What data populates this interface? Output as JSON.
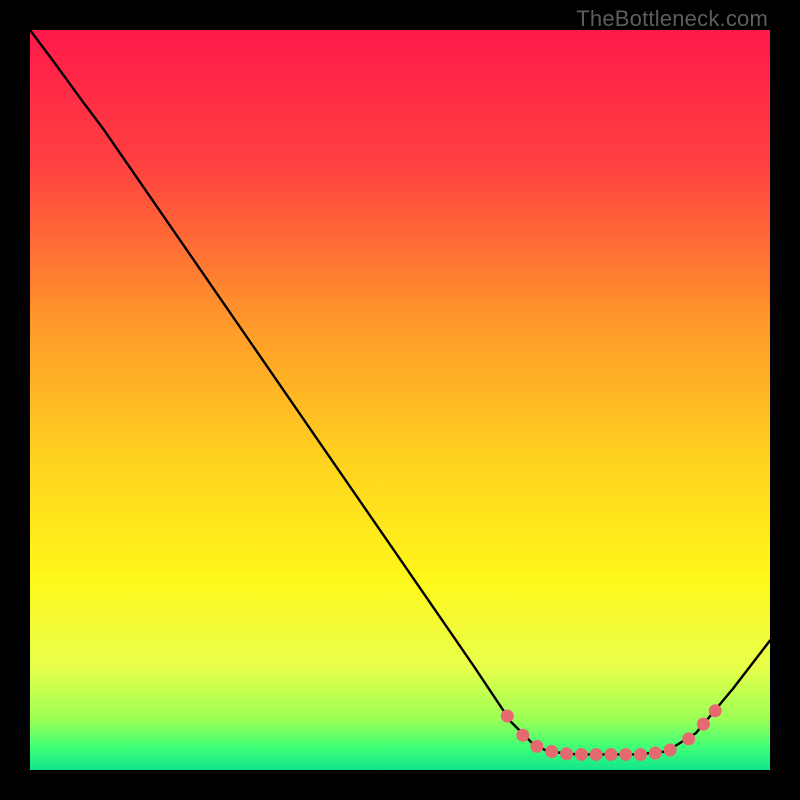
{
  "attribution": "TheBottleneck.com",
  "chart_data": {
    "type": "line",
    "title": "",
    "xlabel": "",
    "ylabel": "",
    "xlim": [
      0,
      100
    ],
    "ylim": [
      0,
      100
    ],
    "gradient_stops": [
      {
        "offset": 0,
        "color": "#ff1a4b"
      },
      {
        "offset": 18,
        "color": "#ff4040"
      },
      {
        "offset": 40,
        "color": "#ff9a2a"
      },
      {
        "offset": 58,
        "color": "#ffd21f"
      },
      {
        "offset": 74,
        "color": "#fff71a"
      },
      {
        "offset": 86,
        "color": "#e8ff4a"
      },
      {
        "offset": 93,
        "color": "#9dff55"
      },
      {
        "offset": 97,
        "color": "#3dff77"
      },
      {
        "offset": 100,
        "color": "#12e68a"
      }
    ],
    "curve": [
      {
        "x": 0.0,
        "y": 100.0
      },
      {
        "x": 3.0,
        "y": 96.0
      },
      {
        "x": 7.0,
        "y": 90.5
      },
      {
        "x": 10.0,
        "y": 86.5
      },
      {
        "x": 20.0,
        "y": 72.0
      },
      {
        "x": 30.0,
        "y": 57.5
      },
      {
        "x": 40.0,
        "y": 43.0
      },
      {
        "x": 50.0,
        "y": 28.5
      },
      {
        "x": 60.0,
        "y": 14.0
      },
      {
        "x": 65.0,
        "y": 6.5
      },
      {
        "x": 68.0,
        "y": 3.5
      },
      {
        "x": 70.0,
        "y": 2.5
      },
      {
        "x": 74.0,
        "y": 2.1
      },
      {
        "x": 78.0,
        "y": 2.1
      },
      {
        "x": 82.0,
        "y": 2.1
      },
      {
        "x": 86.0,
        "y": 2.5
      },
      {
        "x": 90.0,
        "y": 5.0
      },
      {
        "x": 95.0,
        "y": 11.0
      },
      {
        "x": 100.0,
        "y": 17.5
      }
    ],
    "markers": [
      {
        "x": 64.5,
        "y": 7.3
      },
      {
        "x": 66.6,
        "y": 4.7
      },
      {
        "x": 68.5,
        "y": 3.2
      },
      {
        "x": 70.5,
        "y": 2.5
      },
      {
        "x": 72.5,
        "y": 2.2
      },
      {
        "x": 74.5,
        "y": 2.1
      },
      {
        "x": 76.5,
        "y": 2.1
      },
      {
        "x": 78.5,
        "y": 2.1
      },
      {
        "x": 80.5,
        "y": 2.1
      },
      {
        "x": 82.5,
        "y": 2.1
      },
      {
        "x": 84.5,
        "y": 2.3
      },
      {
        "x": 86.5,
        "y": 2.7
      },
      {
        "x": 89.0,
        "y": 4.2
      },
      {
        "x": 91.0,
        "y": 6.2
      },
      {
        "x": 92.6,
        "y": 8.0
      }
    ]
  }
}
